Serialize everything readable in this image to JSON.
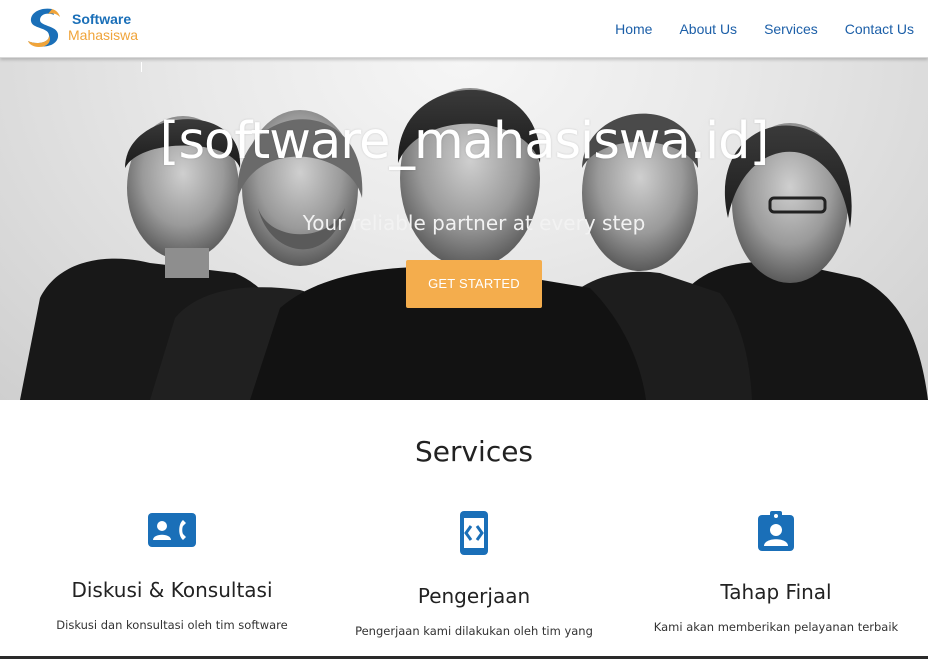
{
  "brand": {
    "line1": "Software",
    "line2": "Mahasiswa"
  },
  "nav": {
    "items": [
      "Home",
      "About Us",
      "Services",
      "Contact Us"
    ]
  },
  "hero": {
    "title": "[software_mahasiswa.id]",
    "subtitle": "Your reliable partner at every step",
    "button": "GET STARTED"
  },
  "services": {
    "title": "Services",
    "items": [
      {
        "icon": "contact-phone-icon",
        "name": "Diskusi & Konsultasi",
        "desc": "Diskusi dan konsultasi oleh tim software"
      },
      {
        "icon": "developer-mode-icon",
        "name": "Pengerjaan",
        "desc": "Pengerjaan kami dilakukan oleh tim yang"
      },
      {
        "icon": "assignment-ind-icon",
        "name": "Tahap Final",
        "desc": "Kami akan memberikan pelayanan terbaik"
      }
    ]
  },
  "colors": {
    "primary": "#1a6fb8",
    "accent": "#f4ad4d",
    "nav_link": "#1c5fa8"
  }
}
